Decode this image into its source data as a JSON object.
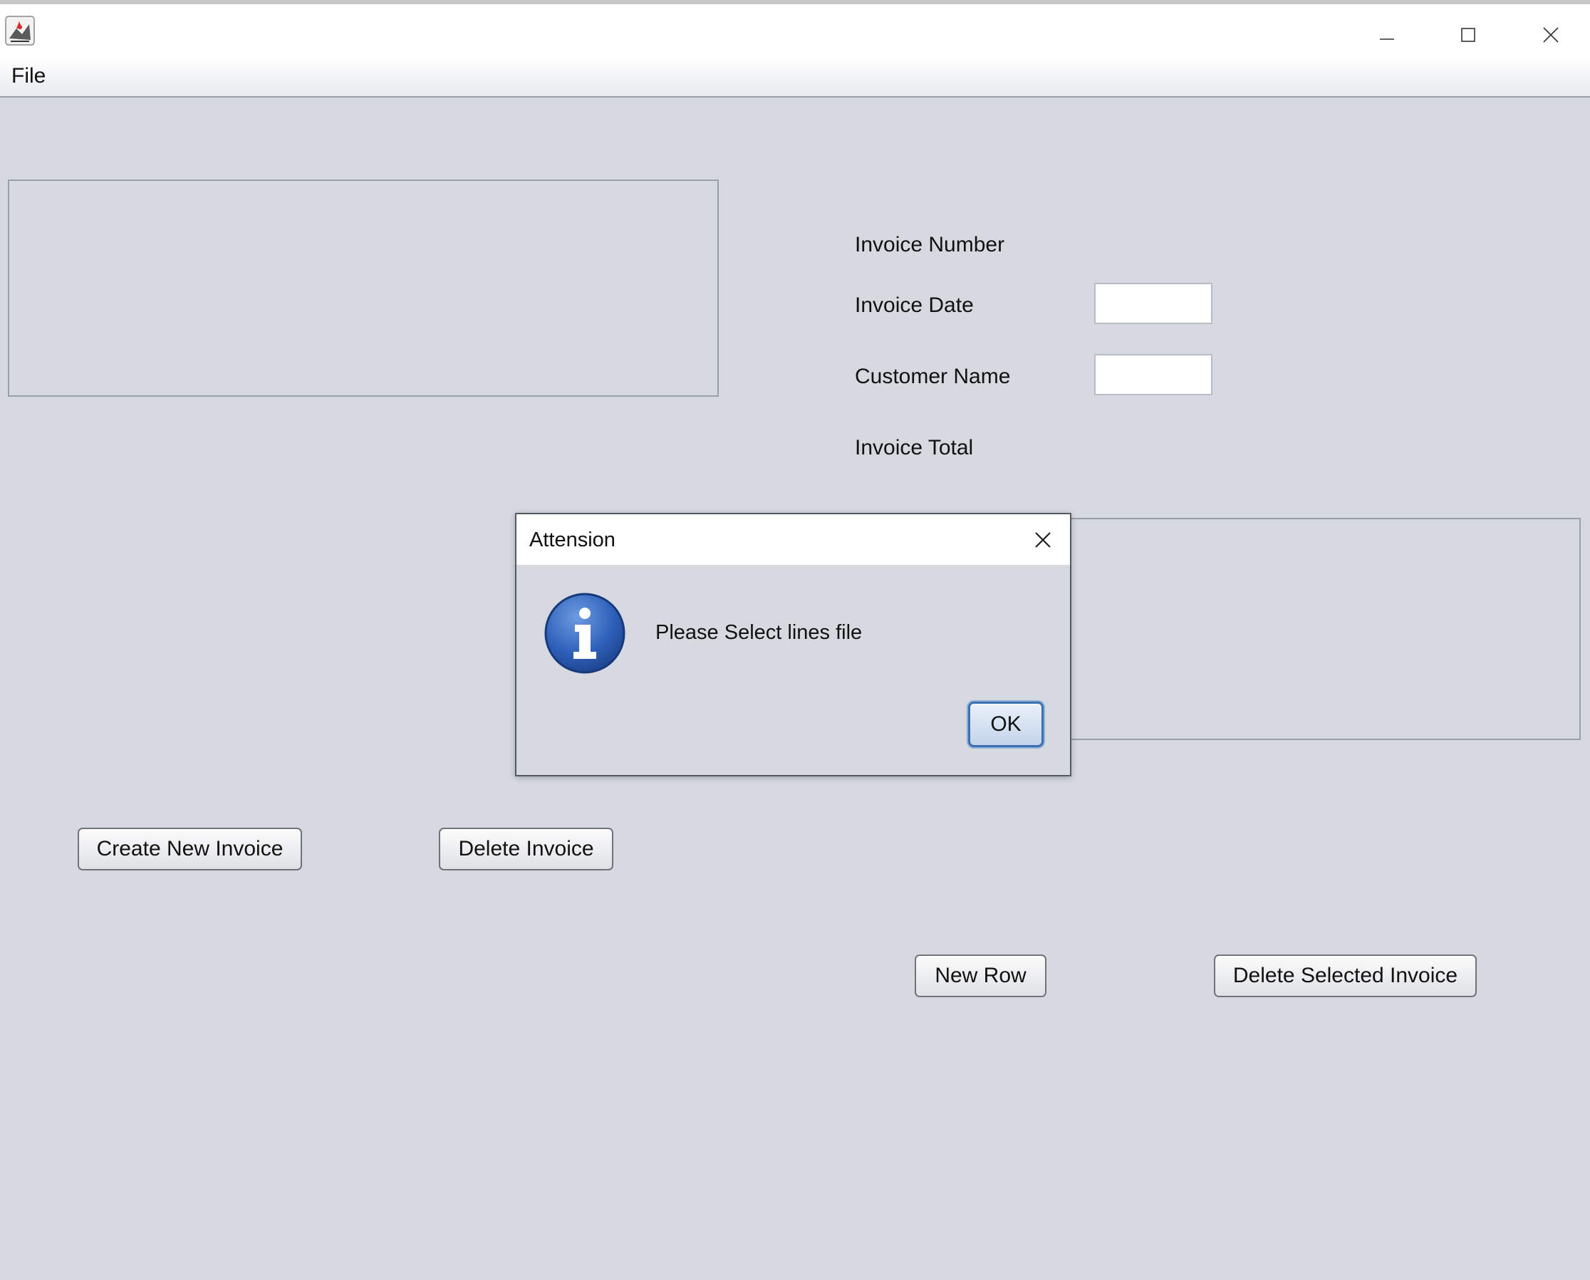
{
  "window": {
    "icon": "java-app-icon",
    "minimize_icon": "minimize-icon",
    "maximize_icon": "maximize-icon",
    "close_icon": "close-icon"
  },
  "menubar": {
    "items": [
      {
        "label": "File"
      }
    ]
  },
  "invoice_form": {
    "invoice_number_label": "Invoice Number",
    "invoice_date_label": "Invoice Date",
    "invoice_date_value": "",
    "customer_name_label": "Customer Name",
    "customer_name_value": "",
    "invoice_total_label": "Invoice Total"
  },
  "buttons": {
    "create_new_invoice": "Create New Invoice",
    "delete_invoice": "Delete Invoice",
    "new_row": "New Row",
    "delete_selected_invoice": "Delete Selected Invoice"
  },
  "dialog": {
    "title": "Attension",
    "message": "Please Select lines file",
    "ok_label": "OK",
    "icon": "info-icon",
    "close_icon": "close-icon"
  },
  "colors": {
    "background": "#d6d9e0",
    "titlebar": "#ffffff",
    "info_icon_blue": "#2b5fb8",
    "ok_border": "#3a6fb0"
  }
}
